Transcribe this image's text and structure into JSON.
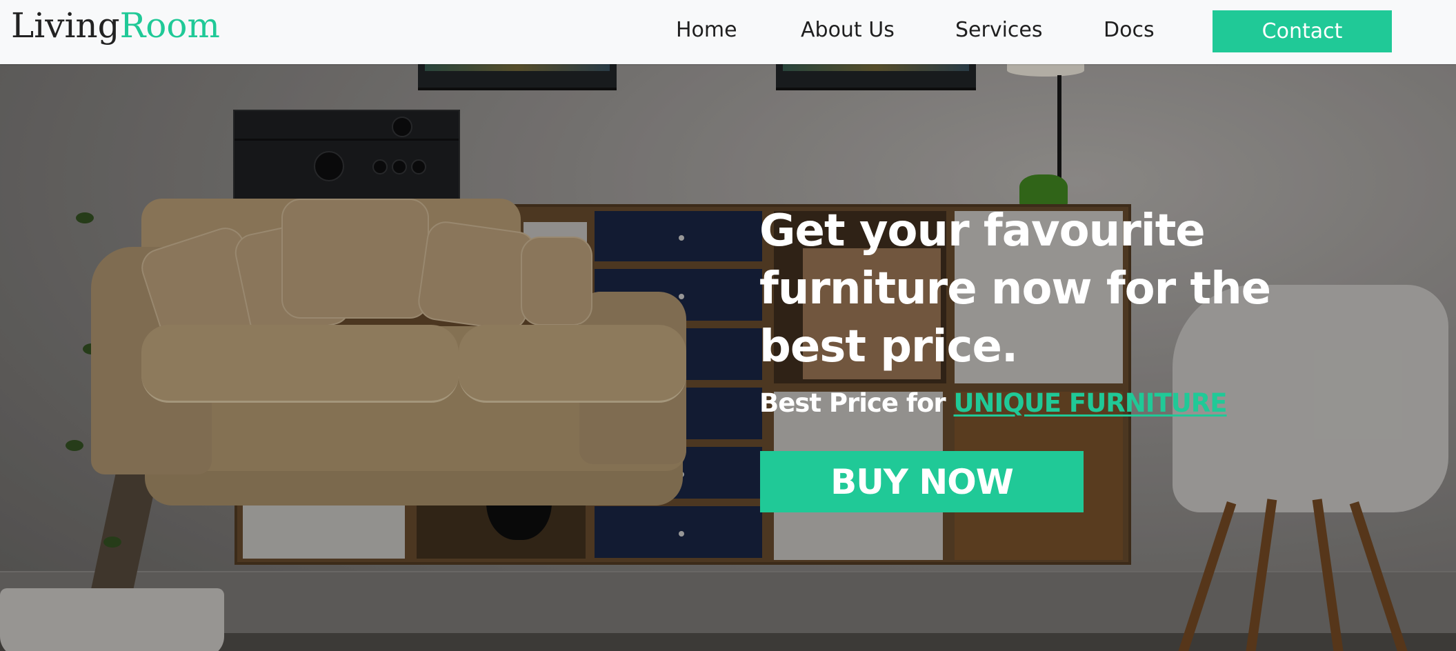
{
  "brand": {
    "part1": "Living",
    "part2": "Room"
  },
  "nav": {
    "items": [
      {
        "label": "Home"
      },
      {
        "label": "About Us"
      },
      {
        "label": "Services"
      },
      {
        "label": "Docs"
      }
    ],
    "contact_label": "Contact"
  },
  "hero": {
    "headline": "Get your favourite furniture now for the best price.",
    "subline_prefix": "Best Price for ",
    "subline_highlight": "UNIQUE FURNITURE",
    "cta_label": "BUY NOW"
  },
  "colors": {
    "accent": "#20c997",
    "navbar_bg": "#f8f9fa",
    "hero_text": "#ffffff"
  }
}
